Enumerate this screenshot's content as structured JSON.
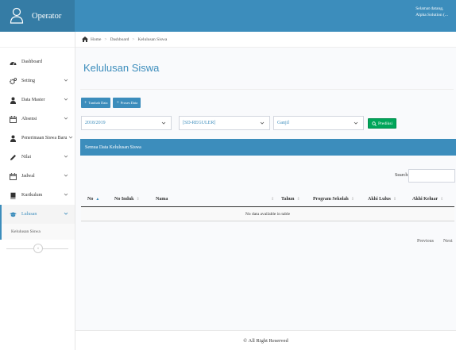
{
  "header": {
    "brand": "Operator",
    "user_line1": "Selamat datang,",
    "user_line2": "Alpha Solution (..."
  },
  "breadcrumb": {
    "home": "Home",
    "sep": ">",
    "dashboard": "Dashboard",
    "current": "Kelulusan Siswa"
  },
  "sidebar": {
    "items": [
      {
        "label": "Dashboard",
        "icon": "dashboard-icon"
      },
      {
        "label": "Setting",
        "icon": "gears-icon"
      },
      {
        "label": "Data Master",
        "icon": "user-icon"
      },
      {
        "label": "Absensi",
        "icon": "calendar-icon"
      },
      {
        "label": "Penerimaan Siswa Baru",
        "icon": "user-icon"
      },
      {
        "label": "Nilai",
        "icon": "pencil-icon"
      },
      {
        "label": "Jadwal",
        "icon": "calendar-icon"
      },
      {
        "label": "Kurikulum",
        "icon": "book-icon"
      },
      {
        "label": "Lulusan",
        "icon": "graduation-icon"
      }
    ],
    "sub_item": "Kelulusan Siswa",
    "collapse_glyph": "‹"
  },
  "page": {
    "title": "Kelulusan Siswa"
  },
  "buttons": {
    "add": "Tambah Data",
    "process": "Proses Data",
    "predict": "Prediksi"
  },
  "filters": {
    "year": "2018/2019",
    "class": "[SD-REGULER]",
    "semester": "Ganjil"
  },
  "box": {
    "title": "Semua Data Kelulusan Siswa"
  },
  "search": {
    "label": "Search:"
  },
  "table": {
    "columns": [
      "No",
      "No Induk",
      "Nama",
      "Tahun",
      "Program Sekolah",
      "Akhi Lulus",
      "Akhi Keluar"
    ],
    "empty": "No data available in table"
  },
  "pager": {
    "prev": "Previous",
    "next": "Next"
  },
  "footer": {
    "text": "© All Right Reserved"
  },
  "colors": {
    "primary": "#3c8dbc",
    "brand": "#357ca5",
    "success": "#00a65a"
  }
}
